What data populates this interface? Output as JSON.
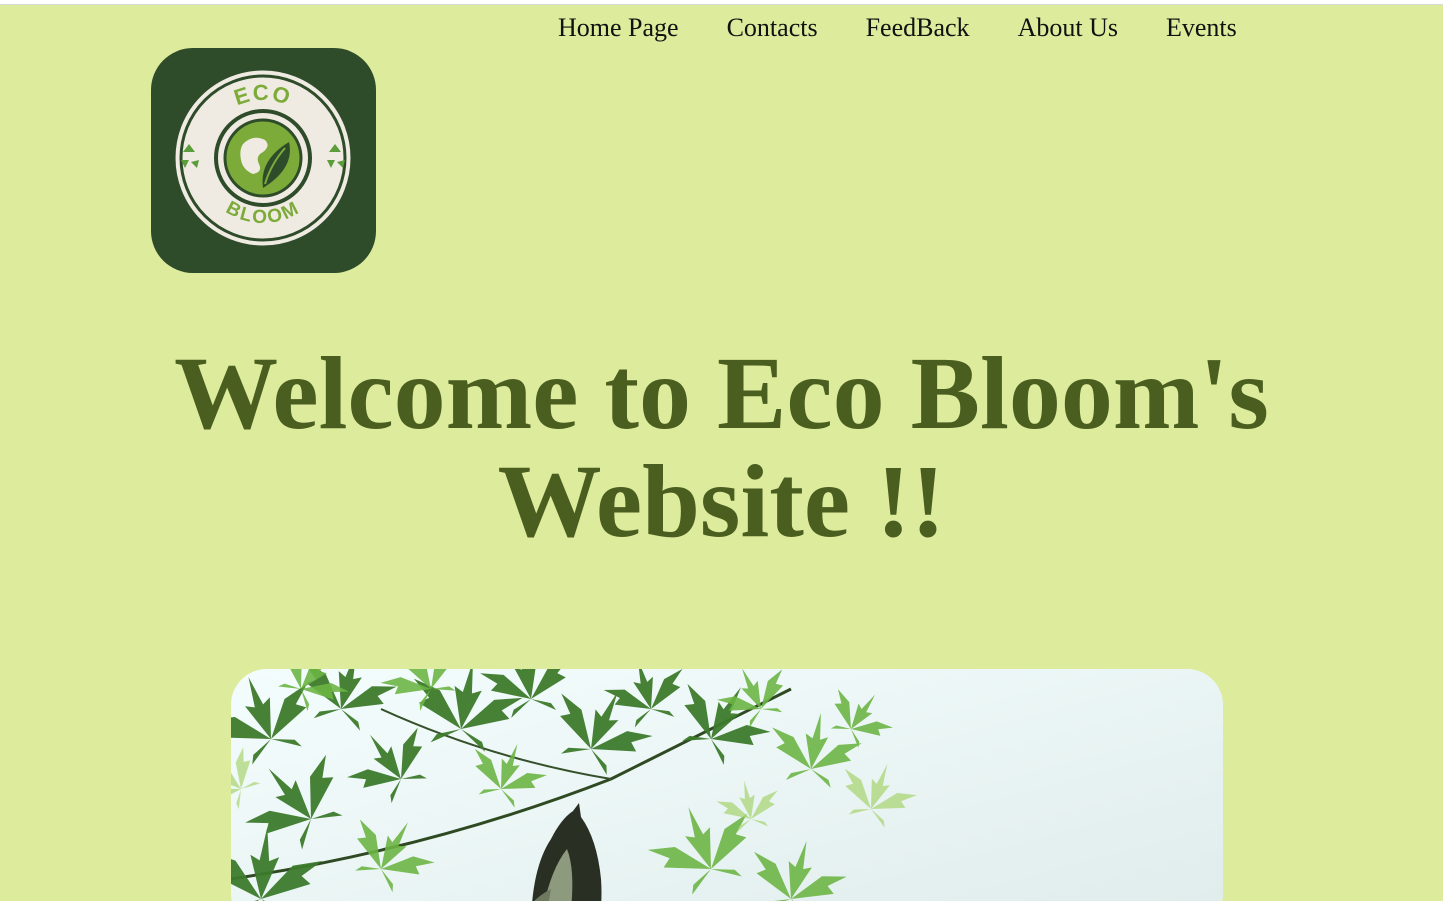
{
  "nav": {
    "items": [
      {
        "label": "Home Page"
      },
      {
        "label": "Contacts"
      },
      {
        "label": "FeedBack"
      },
      {
        "label": "About Us"
      },
      {
        "label": "Events"
      }
    ]
  },
  "logo": {
    "top_text": "ECO",
    "bottom_text": "BLOOM",
    "icon": "eco-bloom-globe-leaf-logo"
  },
  "hero": {
    "title_line1": "Welcome to Eco Bloom's",
    "title_line2": "Website !!"
  },
  "hero_image": {
    "icon": "maple-leaves-bird-photo"
  },
  "colors": {
    "background": "#ddeb9c",
    "title": "#4a5e1f",
    "logo_tile": "#2e4b2a",
    "logo_green": "#7cab3a"
  }
}
